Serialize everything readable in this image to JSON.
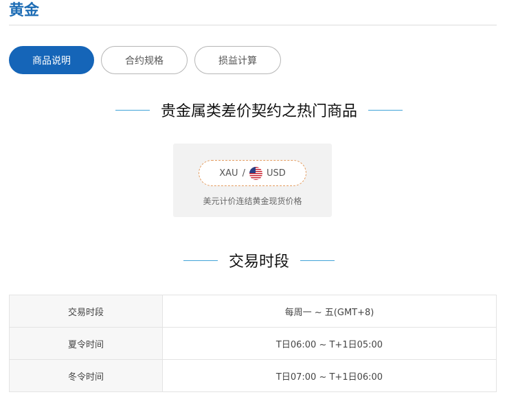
{
  "page": {
    "title": "黄金"
  },
  "tabs": [
    {
      "label": "商品说明",
      "active": true
    },
    {
      "label": "合约规格",
      "active": false
    },
    {
      "label": "损益计算",
      "active": false
    }
  ],
  "sections": {
    "popular": {
      "heading": "贵金属类差价契约之热门商品",
      "product": {
        "base": "XAU",
        "separator": "/",
        "flag_icon": "us-flag-icon",
        "quote": "USD",
        "caption": "美元计价连结黄金现货价格"
      }
    },
    "trading": {
      "heading": "交易时段",
      "rows": [
        {
          "label": "交易时段",
          "value": "每周一 ~ 五(GMT+8)"
        },
        {
          "label": "夏令时间",
          "value": "T日06:00 ~ T+1日05:00"
        },
        {
          "label": "冬令时间",
          "value": "T日07:00 ~ T+1日06:00"
        }
      ]
    }
  },
  "colors": {
    "title": "#1e6db5",
    "active_tab": "#1565b8",
    "heading_rule": "#3fa3d8",
    "pill_border": "#e39a5c"
  }
}
